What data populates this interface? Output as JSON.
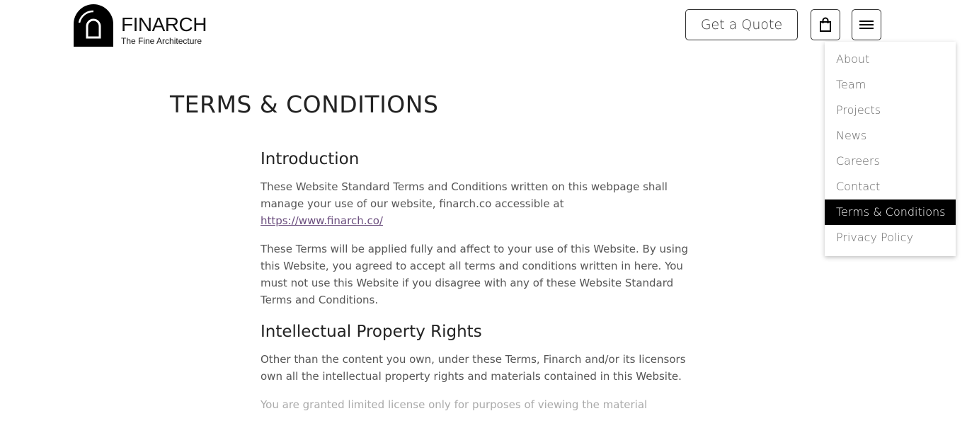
{
  "header": {
    "logo": {
      "name": "FINARCH",
      "tagline": "The Fine Architecture"
    },
    "quote_label": "Get a Quote",
    "icons": {
      "bag": "shopping-bag-icon",
      "menu": "hamburger-menu-icon"
    }
  },
  "menu": {
    "items": [
      {
        "label": "About"
      },
      {
        "label": "Team"
      },
      {
        "label": "Projects"
      },
      {
        "label": "News"
      },
      {
        "label": "Careers"
      },
      {
        "label": "Contact"
      },
      {
        "label": "Terms & Conditions",
        "active": true
      },
      {
        "label": "Privacy Policy"
      }
    ],
    "active_bg": "#000000",
    "active_color": "#ffffff"
  },
  "main": {
    "title": "TERMS & CONDITIONS",
    "sections": [
      {
        "heading": "Introduction",
        "p1": "These Website Standard Terms and Conditions written on this webpage shall manage your use of our website, finarch.co accessible at",
        "link": "https://www.finarch.co/",
        "p2": "These Terms will be applied fully and affect to your use of this Website. By using this Website, you agreed to accept all terms and conditions written in here. You must not use this Website if you disagree with any of these Website Standard Terms and Conditions."
      },
      {
        "heading": "Intellectual Property Rights",
        "p1": "Other than the content you own, under these Terms, Finarch and/or its licensors own all the intellectual property rights and materials contained in this Website.",
        "p2": "You are granted limited license only for purposes of viewing the material"
      }
    ]
  }
}
